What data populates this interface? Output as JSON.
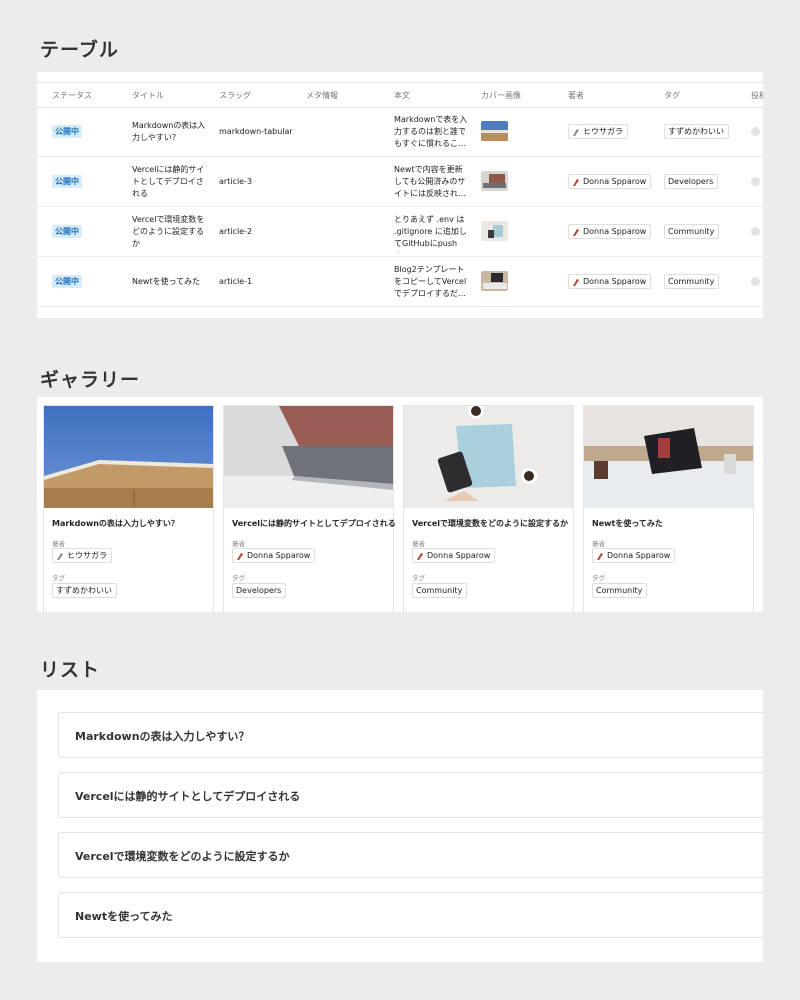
{
  "table": {
    "title": "テーブル",
    "headers": [
      "ステータス",
      "タイトル",
      "スラッグ",
      "メタ情報",
      "本文",
      "カバー画像",
      "著者",
      "タグ",
      "投稿"
    ],
    "rows": [
      {
        "status": "公開中",
        "title": "Markdownの表は入力しやすい？",
        "slug": "markdown-tabular",
        "meta": "",
        "body": "Markdownで表を入力するのは割と誰でもすぐに慣れるこ…",
        "author": "ヒウサガラ",
        "tag": "すずめかわいい"
      },
      {
        "status": "公開中",
        "title": "Vercelには静的サイトとしてデプロイされる",
        "slug": "article-3",
        "meta": "",
        "body": "Newtで内容を更新しても公開済みのサイトには反映され…",
        "author": "Donna Spparow",
        "tag": "Developers"
      },
      {
        "status": "公開中",
        "title": "Vercelで環境変数をどのように設定するか",
        "slug": "article-2",
        "meta": "",
        "body": "とりあえず .env は .gitignore に追加してGitHubにpushす…",
        "author": "Donna Spparow",
        "tag": "Community"
      },
      {
        "status": "公開中",
        "title": "Newtを使ってみた",
        "slug": "article-1",
        "meta": "",
        "body": "Blog2テンプレートをコピーしてVercelでデプロイするだ…",
        "author": "Donna Spparow",
        "tag": "Community"
      }
    ]
  },
  "gallery": {
    "title": "ギャラリー",
    "author_label": "著者",
    "tag_label": "タグ",
    "cards": [
      {
        "title": "Markdownの表は入力しやすい？",
        "author": "ヒウサガラ",
        "tag": "すずめかわいい"
      },
      {
        "title": "Vercelには静的サイトとしてデプロイされる",
        "author": "Donna Spparow",
        "tag": "Developers"
      },
      {
        "title": "Vercelで環境変数をどのように設定するか",
        "author": "Donna Spparow",
        "tag": "Community"
      },
      {
        "title": "Newtを使ってみた",
        "author": "Donna Spparow",
        "tag": "Community"
      }
    ]
  },
  "list": {
    "title": "リスト",
    "items": [
      "Markdownの表は入力しやすい？",
      "Vercelには静的サイトとしてデプロイされる",
      "Vercelで環境変数をどのように設定するか",
      "Newtを使ってみた"
    ]
  },
  "colors": {
    "background": "#ececec",
    "status_badge_bg": "#d6ebfb",
    "status_badge_text": "#1c6fb8"
  }
}
